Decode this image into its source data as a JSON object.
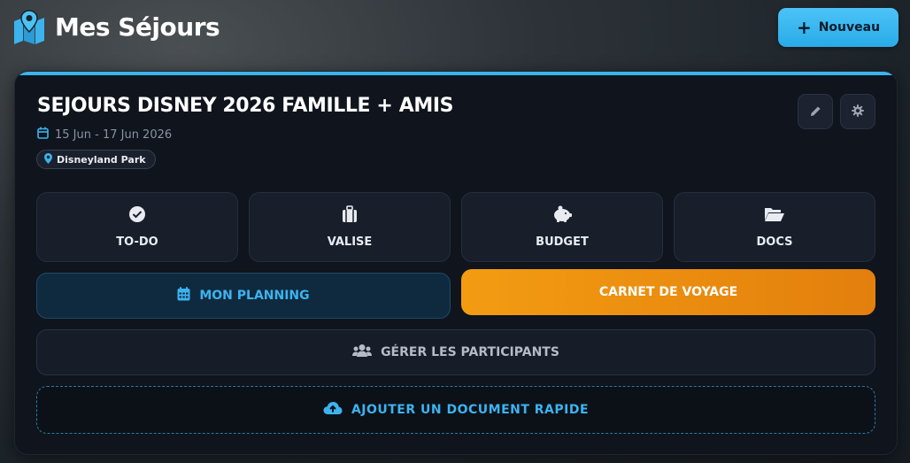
{
  "header": {
    "title": "Mes Séjours",
    "new_button_label": "Nouveau",
    "icon": "map-pin-icon"
  },
  "trip": {
    "title": "SEJOURS DISNEY 2026 FAMILLE + AMIS",
    "dates": "15 Jun - 17 Jun 2026",
    "location": "Disneyland Park"
  },
  "tiles": [
    {
      "label": "TO-DO",
      "icon": "check-circle-icon"
    },
    {
      "label": "VALISE",
      "icon": "suitcase-icon"
    },
    {
      "label": "BUDGET",
      "icon": "piggy-bank-icon"
    },
    {
      "label": "DOCS",
      "icon": "folder-open-icon"
    }
  ],
  "actions": {
    "planning": "MON PLANNING",
    "carnet": "CARNET DE VOYAGE",
    "participants": "GÉRER LES PARTICIPANTS",
    "upload": "AJOUTER UN DOCUMENT RAPIDE"
  },
  "colors": {
    "accent": "#3bb4ee",
    "orange": "#f39c12",
    "card_bg": "#0f141d"
  }
}
